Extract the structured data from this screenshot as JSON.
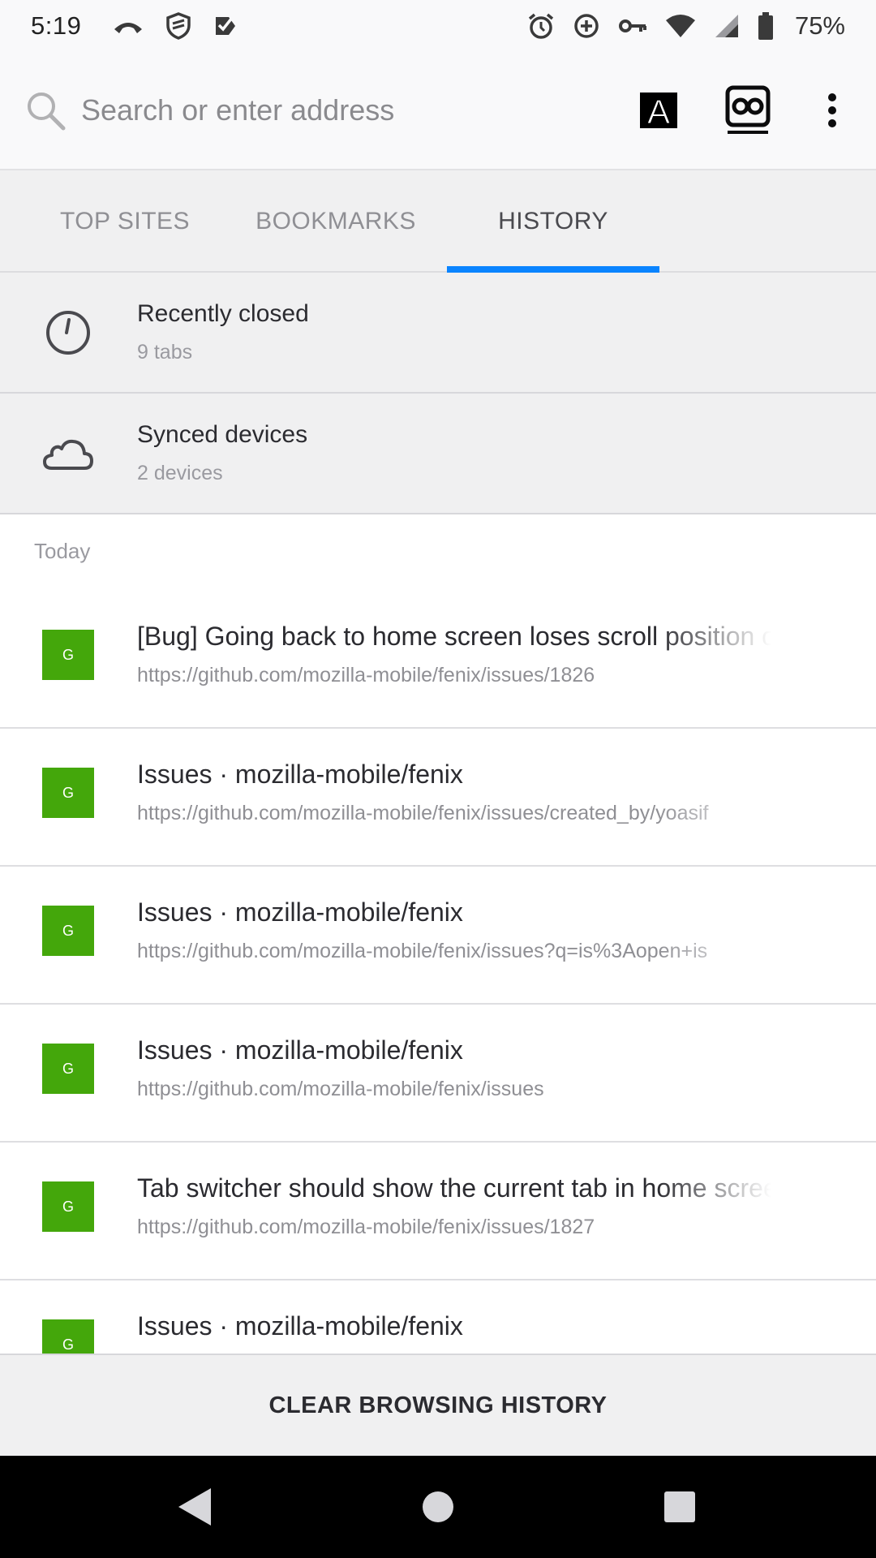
{
  "status_bar": {
    "time": "5:19",
    "battery": "75%",
    "left_icons": [
      "call-icon",
      "shield-icon",
      "checkmark-badge-icon"
    ],
    "right_icons": [
      "alarm-icon",
      "data-saver-icon",
      "vpn-key-icon",
      "wifi-icon",
      "signal-icon",
      "battery-icon"
    ]
  },
  "toolbar": {
    "search_placeholder": "Search or enter address",
    "reader_mode_letter": "A"
  },
  "tabs": [
    {
      "label": "TOP SITES",
      "selected": false
    },
    {
      "label": "BOOKMARKS",
      "selected": false
    },
    {
      "label": "HISTORY",
      "selected": true
    }
  ],
  "special_rows": {
    "recently_closed": {
      "title": "Recently closed",
      "subtitle": "9 tabs",
      "icon": "clock-icon"
    },
    "synced_devices": {
      "title": "Synced devices",
      "subtitle": "2 devices",
      "icon": "cloud-icon"
    }
  },
  "history": {
    "section_label": "Today",
    "items": [
      {
        "favicon": "G",
        "title": "[Bug] Going back to home screen loses scroll position on",
        "url": "https://github.com/mozilla-mobile/fenix/issues/1826"
      },
      {
        "favicon": "G",
        "title": "Issues · mozilla-mobile/fenix",
        "url": "https://github.com/mozilla-mobile/fenix/issues/created_by/yoasif"
      },
      {
        "favicon": "G",
        "title": "Issues · mozilla-mobile/fenix",
        "url": "https://github.com/mozilla-mobile/fenix/issues?q=is%3Aopen+is"
      },
      {
        "favicon": "G",
        "title": "Issues · mozilla-mobile/fenix",
        "url": "https://github.com/mozilla-mobile/fenix/issues"
      },
      {
        "favicon": "G",
        "title": "Tab switcher should show the current tab in home screen",
        "url": "https://github.com/mozilla-mobile/fenix/issues/1827"
      },
      {
        "favicon": "G",
        "title": "Issues · mozilla-mobile/fenix",
        "url": ""
      }
    ]
  },
  "clear_button": {
    "label": "CLEAR BROWSING HISTORY"
  },
  "colors": {
    "accent": "#0a84ff",
    "favicon_bg": "#44a70b",
    "nav_bar": "#000000"
  }
}
